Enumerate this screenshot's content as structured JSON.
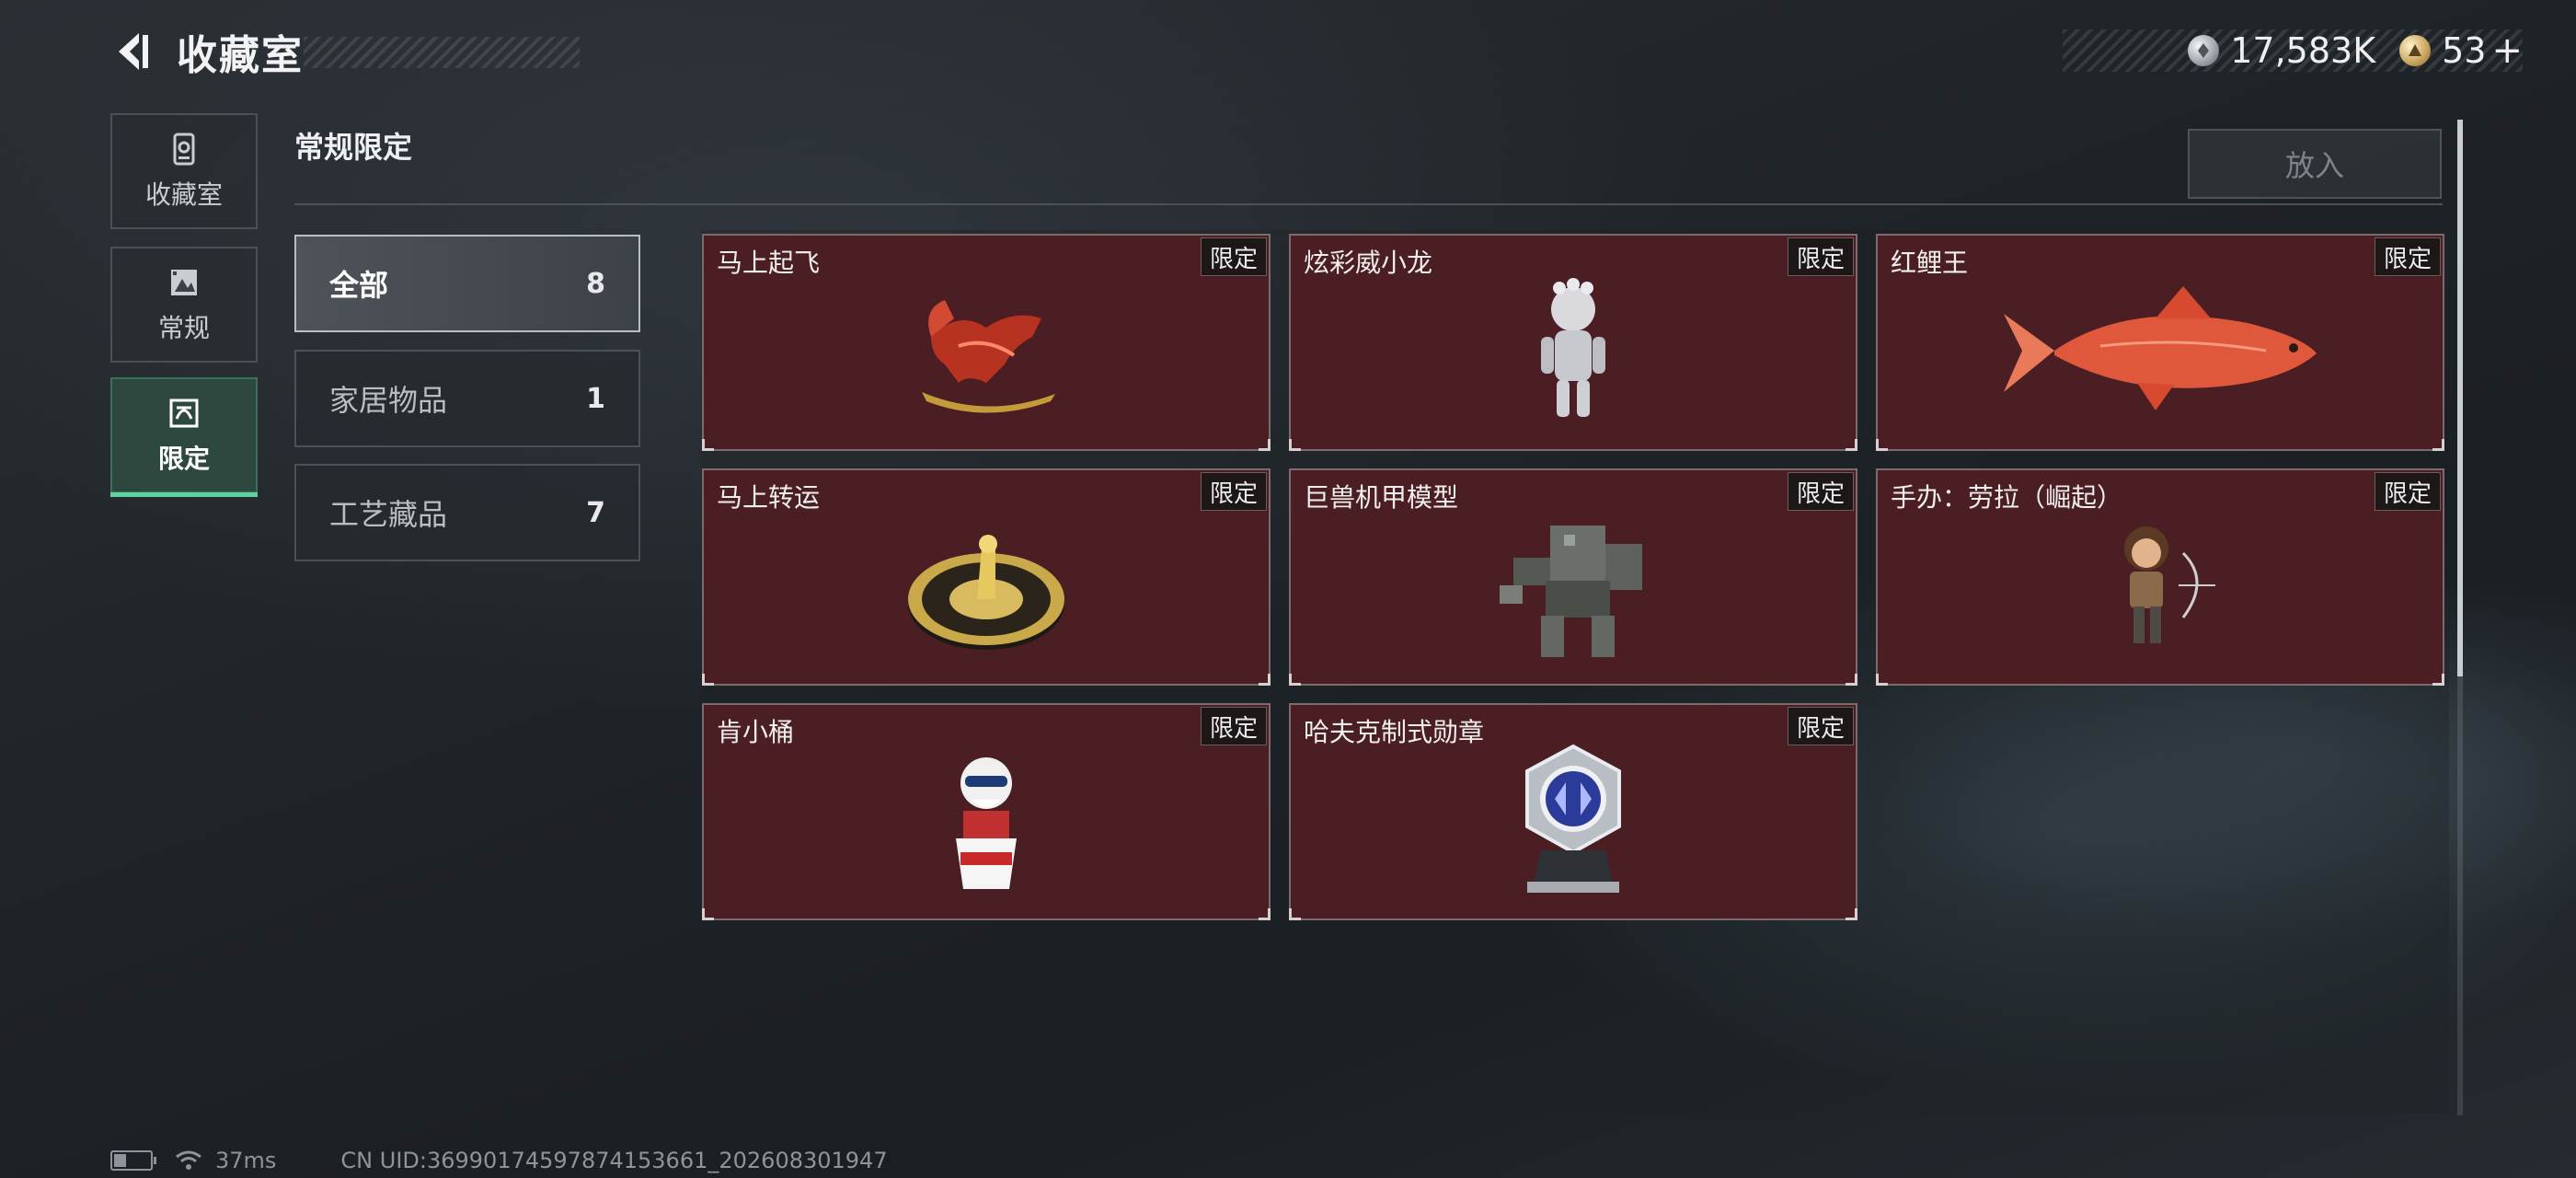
{
  "header": {
    "title": "收藏室",
    "currency": [
      {
        "icon": "silver-coin-icon",
        "value": "17,583K"
      },
      {
        "icon": "gold-coin-icon",
        "value": "53"
      }
    ],
    "add_label": "+"
  },
  "rail": {
    "items": [
      {
        "label": "收藏室",
        "icon": "collection-icon",
        "active": false
      },
      {
        "label": "常规",
        "icon": "picture-icon",
        "active": false
      },
      {
        "label": "限定",
        "icon": "limited-icon",
        "active": true
      }
    ]
  },
  "section_title": "常规限定",
  "place_button": "放入",
  "categories": [
    {
      "name": "全部",
      "count": "8",
      "active": true
    },
    {
      "name": "家居物品",
      "count": "1",
      "active": false
    },
    {
      "name": "工艺藏品",
      "count": "7",
      "active": false
    }
  ],
  "items": [
    {
      "name": "马上起飞",
      "tag": "限定",
      "art": "horse-statue"
    },
    {
      "name": "炫彩威小龙",
      "tag": "限定",
      "art": "silver-figure"
    },
    {
      "name": "红鲤王",
      "tag": "限定",
      "art": "red-carp"
    },
    {
      "name": "马上转运",
      "tag": "限定",
      "art": "golden-turntable"
    },
    {
      "name": "巨兽机甲模型",
      "tag": "限定",
      "art": "mech-model"
    },
    {
      "name": "手办：劳拉（崛起）",
      "tag": "限定",
      "art": "lara-figure"
    },
    {
      "name": "肯小桶",
      "tag": "限定",
      "art": "bucket-figure"
    },
    {
      "name": "哈夫克制式勋章",
      "tag": "限定",
      "art": "medal"
    }
  ],
  "status": {
    "ping": "37ms",
    "uid": "CN UID:3699017459787415366​1_202608301947"
  },
  "colors": {
    "accent": "#5fd39f",
    "card_bg": "#4a1e22"
  }
}
